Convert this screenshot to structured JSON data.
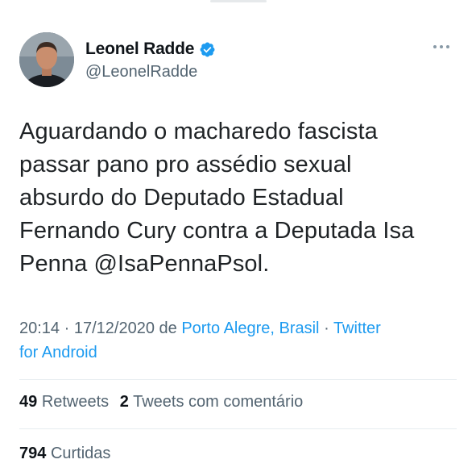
{
  "tweet": {
    "author": {
      "display_name": "Leonel Radde",
      "handle": "@LeonelRadde",
      "verified_icon": "verified-badge-icon",
      "avatar_colors": {
        "bg": "#6b7a86",
        "skin": "#c98e6e",
        "shirt": "#1a1d22",
        "hair": "#3a2a22"
      }
    },
    "more_icon": "more-options-icon",
    "text_lines": [
      "Aguardando o macharedo fascista",
      "passar pano pro assédio sexual",
      "absurdo do Deputado Estadual",
      "Fernando Cury contra a Deputada Isa",
      "Penna @IsaPennaPsol."
    ],
    "meta": {
      "time": "20:14",
      "separator1": " · ",
      "date": "17/12/2020",
      "from": " de ",
      "location": "Porto Alegre, Brasil",
      "separator2": " · ",
      "source_part1": "Twitter",
      "source_part2": "for Android"
    },
    "stats": {
      "retweets_count": "49",
      "retweets_label": "Retweets",
      "quotes_count": "2",
      "quotes_label": "Tweets com comentário",
      "likes_count": "794",
      "likes_label": "Curtidas"
    },
    "colors": {
      "text": "#0f1419",
      "secondary": "#536471",
      "link": "#1d9bf0",
      "divider": "#e6ecf0"
    }
  }
}
